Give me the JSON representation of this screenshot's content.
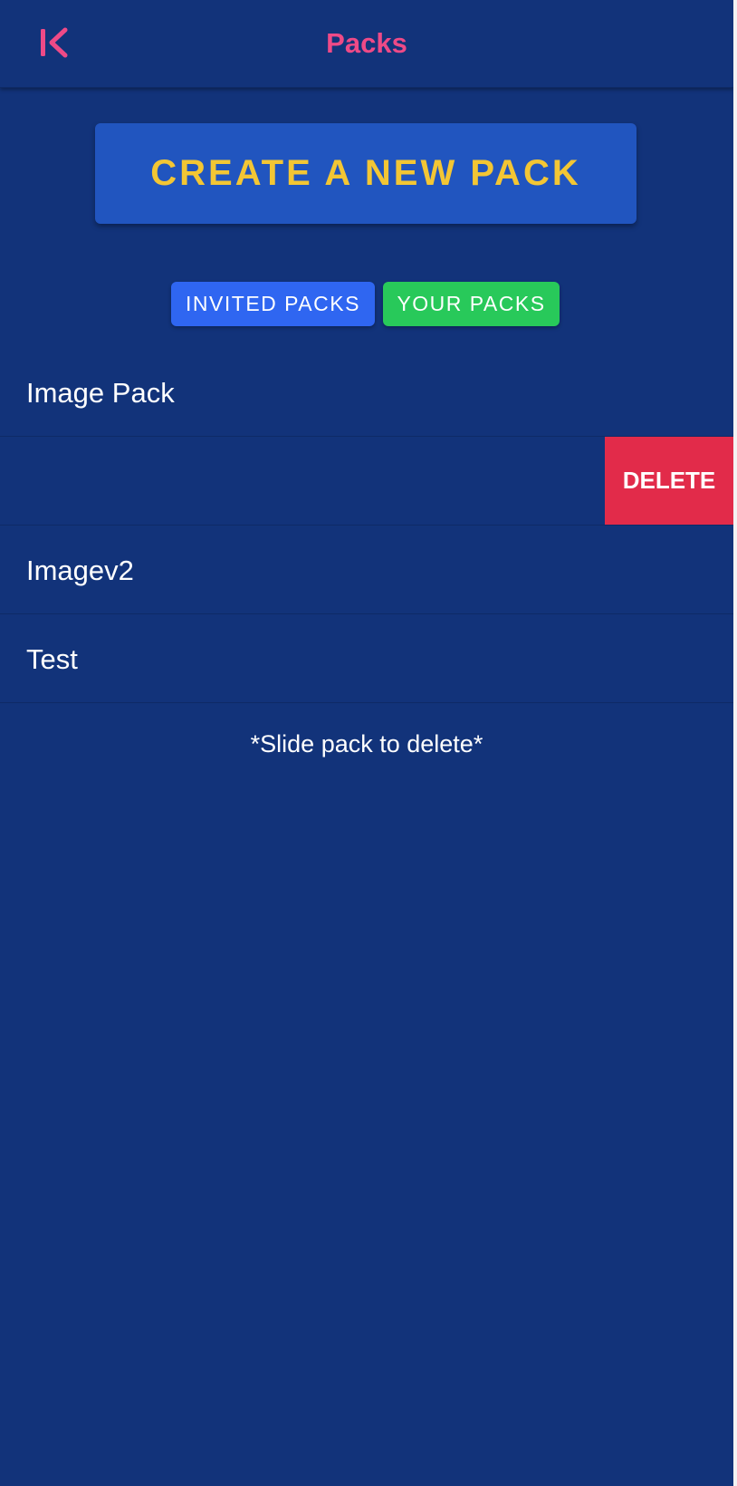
{
  "header": {
    "title": "Packs",
    "back_icon": "back-chevron-icon",
    "title_color": "#ee4a87"
  },
  "create_button": {
    "label": "CREATE A NEW PACK"
  },
  "tabs": [
    {
      "label": "INVITED PACKS",
      "color": "#2f66f1"
    },
    {
      "label": "YOUR PACKS",
      "color": "#28c95a"
    }
  ],
  "packs": [
    {
      "label": "Image Pack"
    },
    {
      "label": "",
      "delete_label": "DELETE"
    },
    {
      "label": "Imagev2"
    },
    {
      "label": "Test"
    }
  ],
  "hint": "*Slide pack to delete*",
  "colors": {
    "background": "#12337a",
    "create_button_bg": "#2155bf",
    "create_button_text": "#f3c634",
    "delete": "#e22b4a"
  }
}
